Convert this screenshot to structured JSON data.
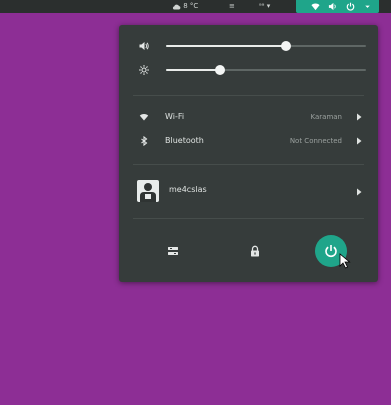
{
  "topbar": {
    "weather": "8 °C",
    "indicator_a": "≡",
    "indicator_b": "ᵃᵃ ▾"
  },
  "tray_icons": [
    "wifi-icon",
    "volume-icon",
    "power-icon",
    "chevron-down-icon"
  ],
  "volume": {
    "icon": "volume-icon",
    "level": 0.6
  },
  "brightness": {
    "icon": "brightness-icon",
    "level": 0.27
  },
  "wifi": {
    "label": "Wi-Fi",
    "value": "Karaman"
  },
  "bluetooth": {
    "label": "Bluetooth",
    "value": "Not Connected"
  },
  "user": {
    "name": "me4cslas"
  },
  "bottom_buttons": [
    "settings-icon",
    "lock-icon",
    "power-icon"
  ],
  "colors": {
    "accent": "#1fa58a",
    "menu_bg": "#363c3b",
    "desktop": "#8d2e95"
  }
}
